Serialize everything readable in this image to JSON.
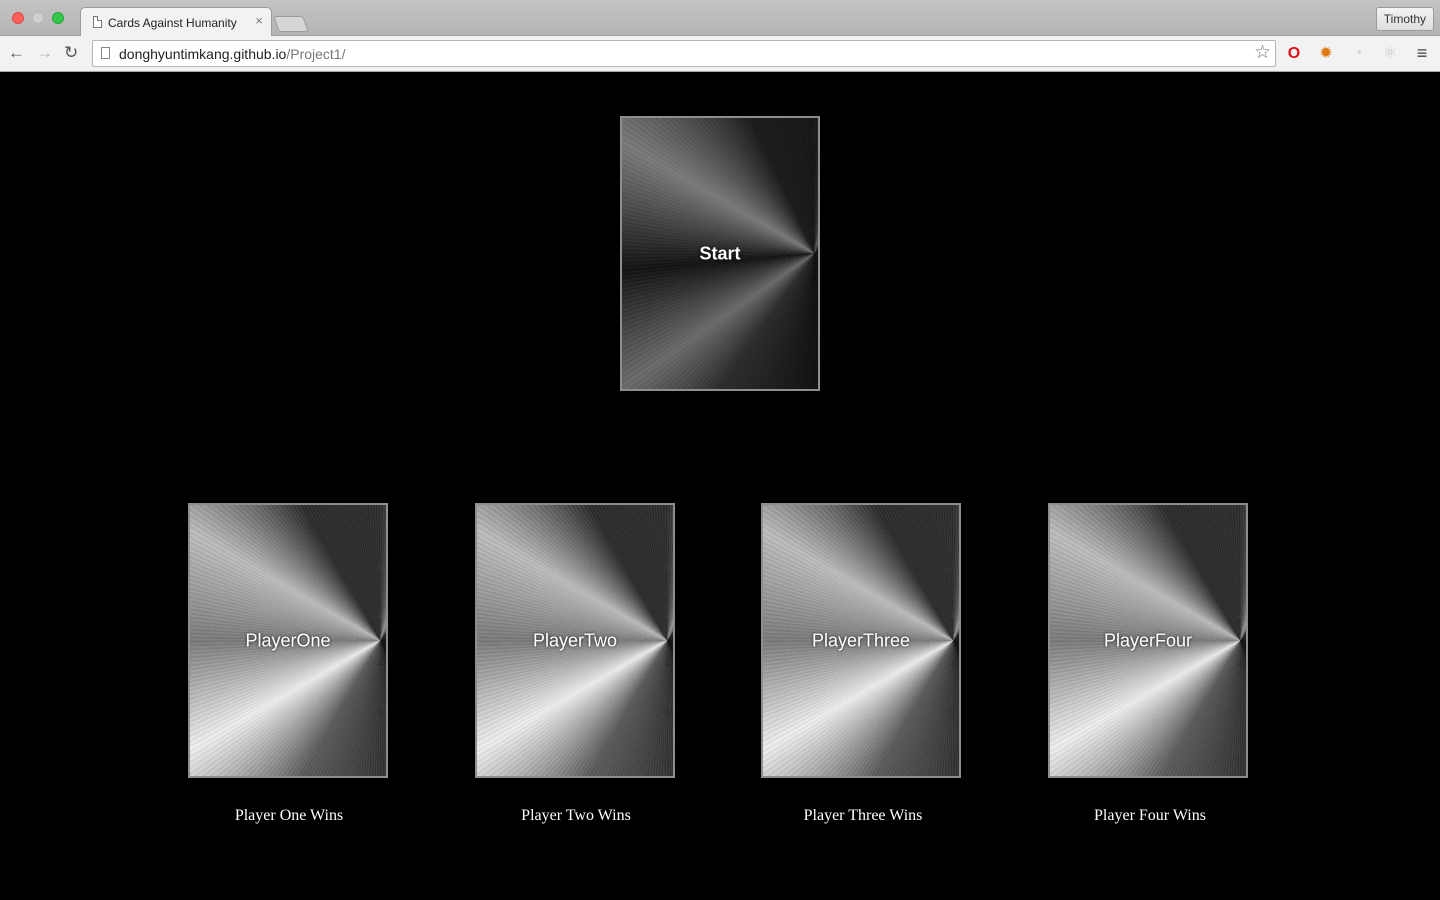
{
  "browser": {
    "tab_title": "Cards Against Humanity",
    "tab_close": "×",
    "profile_name": "Timothy",
    "url_host": "donghyuntimkang.github.io",
    "url_path": "/Project1/",
    "icons": {
      "back": "←",
      "forward": "→",
      "reload": "↻",
      "star": "☆",
      "opera": "O",
      "lion": "✹",
      "ring": "◔",
      "react": "⚛",
      "menu": "≡"
    }
  },
  "game": {
    "start_card_label": "Start",
    "players": [
      {
        "card_label": "PlayerOne",
        "wins_label": "Player One Wins"
      },
      {
        "card_label": "PlayerTwo",
        "wins_label": "Player Two Wins"
      },
      {
        "card_label": "PlayerThree",
        "wins_label": "Player Three Wins"
      },
      {
        "card_label": "PlayerFour",
        "wins_label": "Player Four Wins"
      }
    ]
  }
}
